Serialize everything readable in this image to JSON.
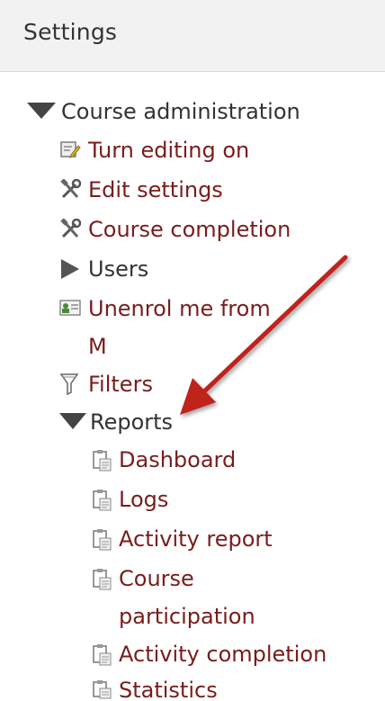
{
  "header": {
    "title": "Settings"
  },
  "tree": {
    "course_admin": {
      "label": "Course administration",
      "icon": "triangle-down-icon"
    },
    "items": {
      "turn_editing_on": "Turn editing on",
      "edit_settings": "Edit settings",
      "course_completion": "Course completion",
      "users": "Users",
      "unenrol_line1": "Unenrol me from",
      "unenrol_line2": "M",
      "filters": "Filters",
      "reports": "Reports"
    },
    "reports": {
      "dashboard": "Dashboard",
      "logs": "Logs",
      "activity_report": "Activity report",
      "course_participation_line1": "Course",
      "course_participation_line2": "participation",
      "activity_completion": "Activity completion",
      "statistics": "Statistics"
    }
  },
  "colors": {
    "link": "#7a1c1c",
    "text": "#333333",
    "header_bg": "#f2f2f2",
    "arrow": "#c0201f"
  },
  "annotation": {
    "icon": "red-arrow-icon"
  }
}
